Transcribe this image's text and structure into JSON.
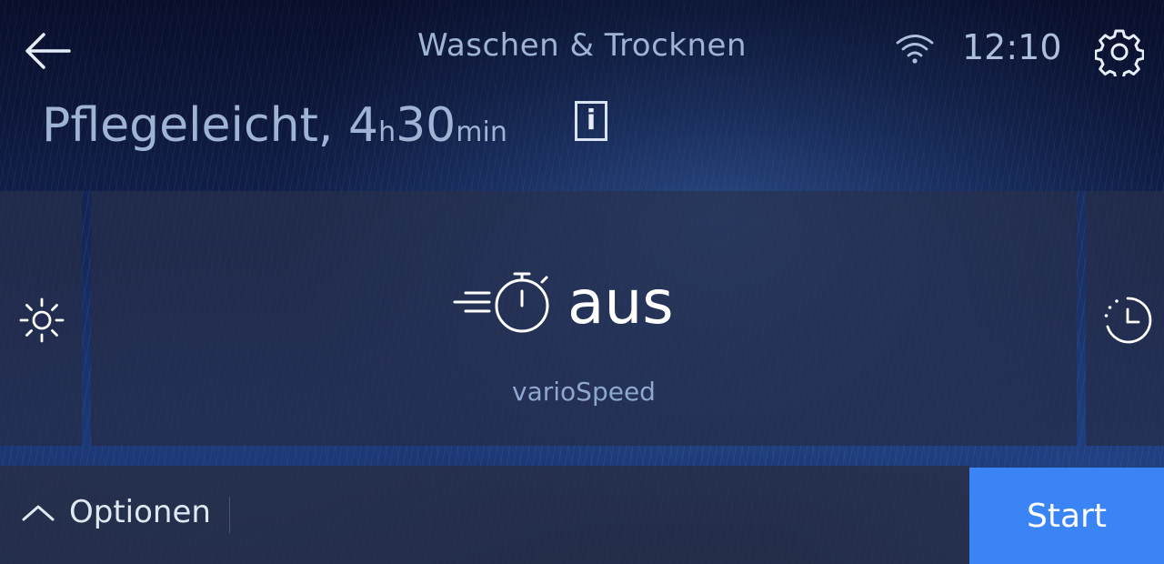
{
  "header": {
    "title": "Waschen & Trocknen",
    "time": "12:10"
  },
  "program": {
    "name": "Pflegeleicht, 4",
    "hours_unit": "h",
    "minutes": "30",
    "minutes_unit": "min",
    "info_label": "i"
  },
  "option_panel": {
    "value": "aus",
    "label": "varioSpeed"
  },
  "footer": {
    "options_label": "Optionen",
    "start_label": "Start"
  },
  "icons": [
    "back-arrow-icon",
    "wifi-icon",
    "gear-icon",
    "sun-icon",
    "vario-speed-icon",
    "timer-icon",
    "chevron-up-icon"
  ],
  "colors": {
    "accent": "#3a84f6",
    "background": "#0b1330"
  }
}
